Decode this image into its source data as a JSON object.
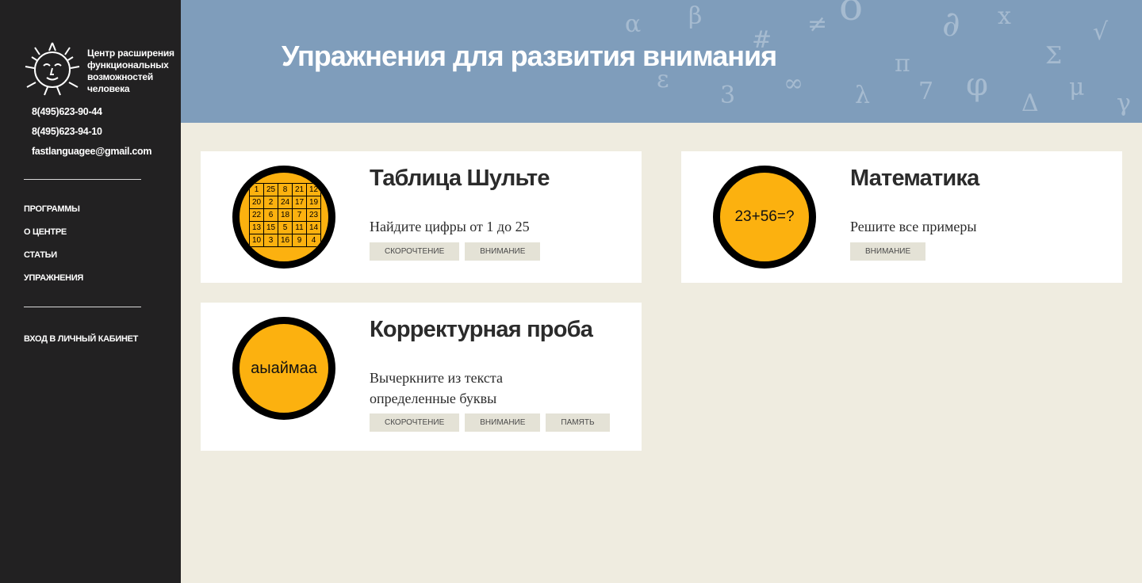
{
  "sidebar": {
    "org_name": "Центр расширения функциональных возможностей человека",
    "phone1": "8(495)623-90-44",
    "phone2": "8(495)623-94-10",
    "email": "fastlanguagee@gmail.com",
    "nav": [
      "ПРОГРАММЫ",
      "О ЦЕНТРЕ",
      "СТАТЬИ",
      "УПРАЖНЕНИЯ"
    ],
    "login": "ВХОД В ЛИЧНЫЙ КАБИНЕТ",
    "logo_icon": "sun-face-icon"
  },
  "header": {
    "title": "Упражнения для развития внимания"
  },
  "cards": [
    {
      "title": "Таблица Шульте",
      "description": "Найдите цифры от 1 до 25",
      "tags": [
        "СКОРОЧТЕНИЕ",
        "ВНИМАНИЕ"
      ],
      "grid": [
        "1",
        "25",
        "8",
        "21",
        "12",
        "20",
        "2",
        "24",
        "17",
        "19",
        "22",
        "6",
        "18",
        "7",
        "23",
        "13",
        "15",
        "5",
        "11",
        "14",
        "10",
        "3",
        "16",
        "9",
        "4"
      ]
    },
    {
      "title": "Математика",
      "description": "Решите все примеры",
      "tags": [
        "ВНИМАНИЕ"
      ],
      "circle_text": "23+56=?"
    },
    {
      "title": "Корректурная проба",
      "description": "Вычеркните из текста определенные буквы",
      "tags": [
        "СКОРОЧТЕНИЕ",
        "ВНИМАНИЕ",
        "ПАМЯТЬ"
      ],
      "circle_text": "аыаймаа"
    }
  ],
  "colors": {
    "sidebar_bg": "#222122",
    "header_bg": "#7f9dbb",
    "page_bg": "#efece0",
    "accent_yellow": "#fcb10f",
    "tag_bg": "#e4e2d6"
  }
}
